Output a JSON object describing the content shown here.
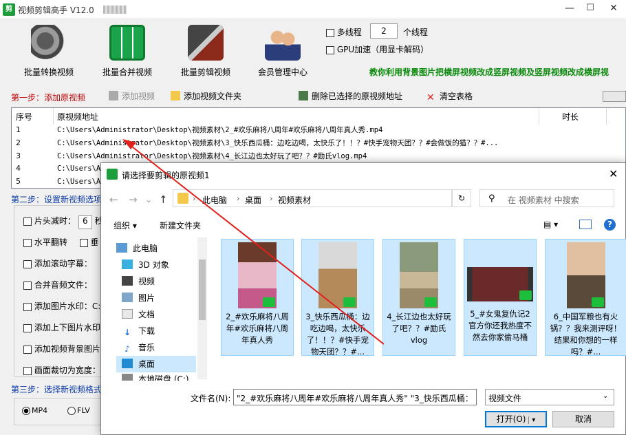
{
  "window": {
    "title": "视频剪辑高手 V12.0",
    "controls": {
      "minimize": "—",
      "maximize": "☐",
      "close": "✕"
    }
  },
  "toolbar": {
    "items": [
      {
        "label": "批量转换视频",
        "icon": "film-reel-icon"
      },
      {
        "label": "批量合并视频",
        "icon": "merge-film-icon"
      },
      {
        "label": "批量剪辑视频",
        "icon": "film-cut-icon"
      },
      {
        "label": "会员管理中心",
        "icon": "members-icon"
      }
    ]
  },
  "options": {
    "multithread_label": "多线程",
    "threads_value": "2",
    "threads_unit": "个线程",
    "gpu_label": "GPU加速（用显卡解码）"
  },
  "promo": "教你利用背景图片把横屏视频改成竖屏视频及竖屏视频改成横屏视",
  "step1": {
    "label": "第一步：添加原视频",
    "add_video": "添加视频",
    "add_folder": "添加视频文件夹",
    "delete_selected": "删除已选择的原视频地址",
    "clear_table": "清空表格"
  },
  "table": {
    "headers": {
      "index": "序号",
      "path": "原视频地址",
      "duration": "时长"
    },
    "rows": [
      {
        "n": "1",
        "path": "C:\\Users\\Administrator\\Desktop\\视频素材\\2_#欢乐麻将八周年#欢乐麻将八周年真人秀.mp4"
      },
      {
        "n": "2",
        "path": "C:\\Users\\Administrator\\Desktop\\视频素材\\3_快乐西瓜桶：边吃边喝，太快乐了！！？#快手宠物天团？？#会做饭的猫？？#..."
      },
      {
        "n": "3",
        "path": "C:\\Users\\Administrator\\Desktop\\视频素材\\4_长江边也太好玩了吧？？#励氏vlog.mp4"
      },
      {
        "n": "4",
        "path": "C:\\Users\\Ad"
      },
      {
        "n": "5",
        "path": "C:\\Users\\Ad"
      }
    ]
  },
  "step2": {
    "label": "第二步：设置新视频选项",
    "options": [
      {
        "label": "片头减时：",
        "value": "6",
        "suffix": "秒"
      },
      {
        "label": "水平翻转",
        "extra": "垂"
      },
      {
        "label": "添加滚动字幕：",
        "value": ""
      },
      {
        "label": "合并音频文件：",
        "value": ""
      },
      {
        "label": "添加图片水印：",
        "value": "C:"
      },
      {
        "label": "添加上下图片水印",
        "value": ""
      },
      {
        "label": "添加视频背景图片",
        "value": ""
      },
      {
        "label": "画面裁切为宽度：",
        "value": ""
      }
    ]
  },
  "step3": {
    "label": "第三步：选择新视频格式",
    "formats": [
      "MP4",
      "FLV"
    ]
  },
  "dialog": {
    "title": "请选择要剪辑的原视频1",
    "crumbs": [
      "此电脑",
      "桌面",
      "视频素材"
    ],
    "search_placeholder": "在 视频素材 中搜索",
    "organize": "组织 ▾",
    "new_folder": "新建文件夹",
    "help": "?",
    "nav_items": [
      {
        "label": "此电脑",
        "icon": "computer-icon"
      },
      {
        "label": "3D 对象",
        "icon": "cube-icon"
      },
      {
        "label": "视频",
        "icon": "video-folder-icon"
      },
      {
        "label": "图片",
        "icon": "pictures-folder-icon"
      },
      {
        "label": "文档",
        "icon": "documents-folder-icon"
      },
      {
        "label": "下载",
        "icon": "download-folder-icon"
      },
      {
        "label": "音乐",
        "icon": "music-folder-icon"
      },
      {
        "label": "桌面",
        "icon": "desktop-folder-icon"
      },
      {
        "label": "本地磁盘 (C:)",
        "icon": "disk-icon"
      }
    ],
    "files": [
      {
        "name": "2_#欢乐麻将八周年#欢乐麻将八周年真人秀",
        "selected": true,
        "thumb_color": "#c45a8a"
      },
      {
        "name": "3_快乐西瓜桶：边吃边喝，太快乐了！！？#快手宠物天团？？#...",
        "selected": true,
        "thumb_color": "#b58a5a"
      },
      {
        "name": "4_长江边也太好玩了吧？？#励氏vlog",
        "selected": true,
        "thumb_color": "#9a8a6a"
      },
      {
        "name": "5_#女鬼复仇记2官方你还我热度不然去你家偷马桶",
        "selected": true,
        "thumb_color": "#6a2a2a"
      },
      {
        "name": "6_中国军粮也有火锅？？我来测评呀！结果和你想的一样吗？#...",
        "selected": true,
        "thumb_color": "#5a4a3a"
      }
    ],
    "filename_label": "文件名(N):",
    "filename_value": "\"2_#欢乐麻将八周年#欢乐麻将八周年真人秀\" \"3_快乐西瓜桶：",
    "filetype": "视频文件",
    "open": "打开(O)",
    "cancel": "取消"
  }
}
